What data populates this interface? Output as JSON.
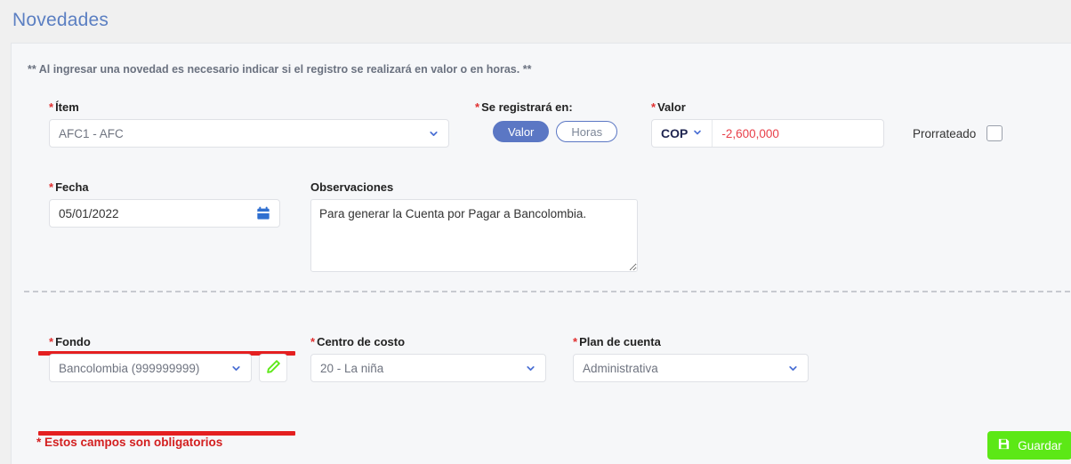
{
  "header": {
    "title": "Novedades",
    "title_color": "#5b7fc2"
  },
  "info_note": "** Al ingresar una novedad es necesario indicar si el registro se realizará en valor o en horas. **",
  "form": {
    "item": {
      "label": "Ítem",
      "required_mark": "*",
      "value": "AFC1 - AFC"
    },
    "registro": {
      "label": "Se registrará en:",
      "required_mark": "*",
      "options": [
        "Valor",
        "Horas"
      ],
      "selected": "Valor",
      "active_color": "#5b77c4"
    },
    "valor": {
      "label": "Valor",
      "required_mark": "*",
      "currency": "COP",
      "amount": "-2,600,000",
      "amount_color": "#e8404a"
    },
    "prorrateado": {
      "label": "Prorrateado",
      "checked": false
    },
    "fecha": {
      "label": "Fecha",
      "required_mark": "*",
      "value": "05/01/2022"
    },
    "observaciones": {
      "label": "Observaciones",
      "value": "Para generar la Cuenta por Pagar a Bancolombia.",
      "placeholder": ""
    },
    "fondo": {
      "label": "Fondo",
      "required_mark": "*",
      "value": "Bancolombia (999999999)",
      "highlight_color": "#e41f20"
    },
    "centro_de_costo": {
      "label": "Centro de costo",
      "required_mark": "*",
      "value": "20 -  La niña"
    },
    "plan_de_cuenta": {
      "label": "Plan de cuenta",
      "required_mark": "*",
      "value": "Administrativa"
    }
  },
  "footer": {
    "required_note": "* Estos campos son obligatorios",
    "save_label": "Guardar",
    "save_color": "#5ce816"
  },
  "icons": {
    "chevron_down": "chevron-down-icon",
    "calendar": "calendar-icon",
    "pencil": "pencil-icon",
    "save": "floppy-disk-icon"
  }
}
